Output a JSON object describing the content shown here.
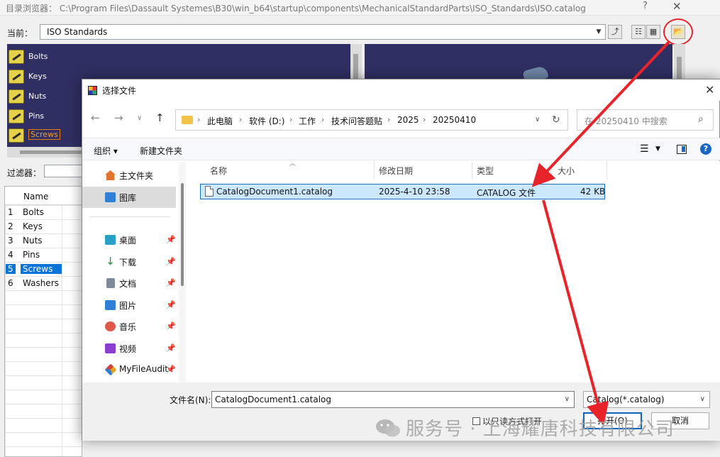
{
  "browser": {
    "title": "目录浏览器： C:\\Program Files\\Dassault Systemes\\B30\\win_b64\\startup\\components\\MechanicalStandardParts\\ISO_Standards\\ISO.catalog",
    "help": "?",
    "close": "✕",
    "current_label": "当前：",
    "current_value": "ISO Standards",
    "filter_label": "过滤器：",
    "tree_items": [
      "Bolts",
      "Keys",
      "Nuts",
      "Pins",
      "Screws"
    ],
    "list_header": "Name",
    "list_rows": [
      {
        "idx": "1",
        "name": "Bolts"
      },
      {
        "idx": "2",
        "name": "Keys"
      },
      {
        "idx": "3",
        "name": "Nuts"
      },
      {
        "idx": "4",
        "name": "Pins"
      },
      {
        "idx": "5",
        "name": "Screws"
      },
      {
        "idx": "6",
        "name": "Washers"
      }
    ]
  },
  "dialog": {
    "title": "选择文件",
    "close": "✕",
    "breadcrumb": [
      "此电脑",
      "软件 (D:)",
      "工作",
      "技术问答题贴",
      "2025",
      "20250410"
    ],
    "search_placeholder": "在 20250410 中搜索",
    "toolbar": {
      "organize": "组织 ▾",
      "new_folder": "新建文件夹"
    },
    "sidebar": [
      {
        "label": "主文件夹",
        "icon": "home-icon",
        "color": "#e2732b"
      },
      {
        "label": "图库",
        "icon": "gallery-icon",
        "color": "#2f7fd6"
      },
      {
        "label": "桌面",
        "icon": "desktop-icon",
        "color": "#2aa0c9"
      },
      {
        "label": "下载",
        "icon": "download-icon",
        "color": "#1d8f3a"
      },
      {
        "label": "文档",
        "icon": "document-icon",
        "color": "#7d8a99"
      },
      {
        "label": "图片",
        "icon": "picture-icon",
        "color": "#2f7fd6"
      },
      {
        "label": "音乐",
        "icon": "music-icon",
        "color": "#e0584a"
      },
      {
        "label": "视频",
        "icon": "video-icon",
        "color": "#8a3fd1"
      },
      {
        "label": "MyFileAudit",
        "icon": "myfileaudit-icon",
        "color": "#e3a21a"
      }
    ],
    "columns": [
      "名称",
      "修改日期",
      "类型",
      "大小"
    ],
    "file": {
      "name": "CatalogDocument1.catalog",
      "modified": "2025-4-10 23:58",
      "type": "CATALOG 文件",
      "size": "42 KB"
    },
    "filename_label": "文件名(N):",
    "filename_value": "CatalogDocument1.catalog",
    "filetype_value": "Catalog(*.catalog)",
    "readonly_label": "以只读方式打开",
    "open_button": "打开(O)",
    "cancel_button": "取消"
  },
  "watermark": "服务号 · 上海耀唐科技有限公司",
  "colors": {
    "annotation": "#e8242a",
    "selection": "#0a74d8",
    "tree_bg": "#302f63"
  }
}
